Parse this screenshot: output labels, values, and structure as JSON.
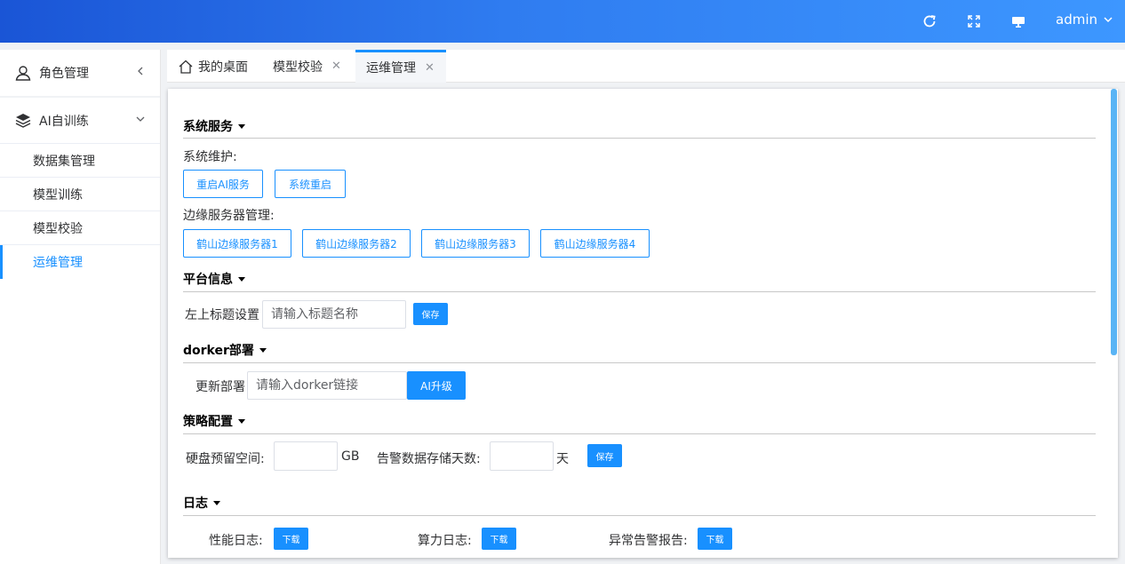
{
  "header": {
    "user": "admin",
    "icons": [
      "refresh-icon",
      "fullscreen-icon",
      "monitor-icon",
      "chevron-down-icon"
    ]
  },
  "sidebar": {
    "groups": [
      {
        "label": "角色管理",
        "icon": "user-icon"
      },
      {
        "label": "AI自训练",
        "icon": "layers-icon",
        "items": [
          "数据集管理",
          "模型训练",
          "模型校验",
          "运维管理"
        ]
      }
    ],
    "active_item": "运维管理"
  },
  "tabs": [
    {
      "label": "我的桌面",
      "icon": "home-icon"
    },
    {
      "label": "模型校验"
    },
    {
      "label": "运维管理",
      "active": true
    }
  ],
  "system_service": {
    "title": "系统服务",
    "maintenance_label": "系统维护:",
    "maintenance_buttons": [
      "重启AI服务",
      "系统重启"
    ],
    "edge_label": "边缘服务器管理:",
    "edge_buttons": [
      "鹤山边缘服务器1",
      "鹤山边缘服务器2",
      "鹤山边缘服务器3",
      "鹤山边缘服务器4"
    ]
  },
  "platform": {
    "title": "平台信息",
    "label": "左上标题设置",
    "placeholder": "请输入标题名称",
    "save": "保存"
  },
  "docker": {
    "title": "dorker部署",
    "label": "更新部署",
    "placeholder": "请输入dorker链接",
    "button": "AI升级"
  },
  "strategy": {
    "title": "策略配置",
    "disk_label": "硬盘预留空间:",
    "disk_unit": "GB",
    "days_label": "告警数据存储天数:",
    "days_unit": "天",
    "save": "保存"
  },
  "logs": {
    "title": "日志",
    "items": [
      {
        "label": "性能日志:",
        "button": "下载"
      },
      {
        "label": "算力日志:",
        "button": "下载"
      },
      {
        "label": "异常告警报告:",
        "button": "下载"
      }
    ]
  },
  "colors": {
    "accent": "#1890ff",
    "header_start": "#1a55d6",
    "header_end": "#3d97ff"
  }
}
